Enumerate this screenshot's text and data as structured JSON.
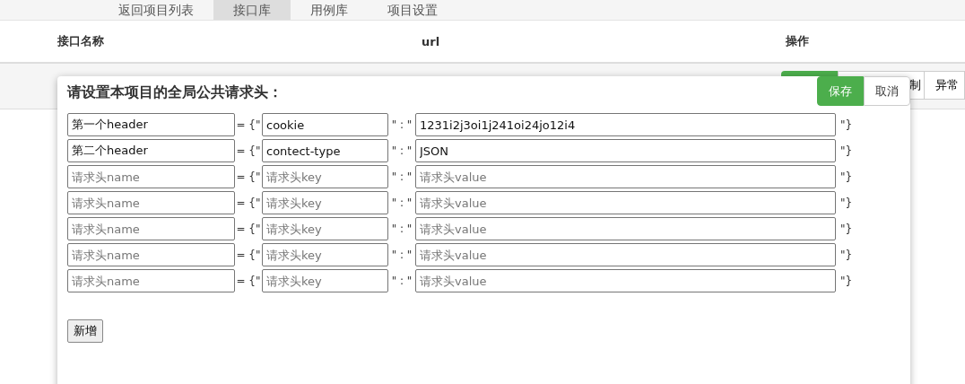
{
  "nav": {
    "tabs": [
      {
        "label": "返回项目列表",
        "selected": false
      },
      {
        "label": "接口库",
        "selected": true
      },
      {
        "label": "用例库",
        "selected": false
      },
      {
        "label": "项目设置",
        "selected": false
      }
    ]
  },
  "table": {
    "columns": [
      "接口名称",
      "url",
      "操作"
    ],
    "row_actions": [
      {
        "label": "制"
      },
      {
        "label": "异常"
      }
    ]
  },
  "dialog": {
    "title": "请设置本项目的全局公共请求头：",
    "save": "保存",
    "cancel": "取消",
    "rows": [
      {
        "name": "第一个header",
        "eq": "= {\"",
        "key": "cookie",
        "colon": "\" : \"",
        "value": "1231i2j3oi1j241oi24jo12i4",
        "close": "\"}"
      },
      {
        "name": "第二个header",
        "eq": "= {\"",
        "key": "contect-type",
        "colon": "\" : \"",
        "value": "JSON",
        "close": "\"}"
      },
      {
        "name_placeholder": "请求头name",
        "eq": "= {\"",
        "key_placeholder": "请求头key",
        "colon": "\" : \"",
        "value_placeholder": "请求头value",
        "close": "\"}"
      },
      {
        "name_placeholder": "请求头name",
        "eq": "= {\"",
        "key_placeholder": "请求头key",
        "colon": "\" : \"",
        "value_placeholder": "请求头value",
        "close": "\"}"
      },
      {
        "name_placeholder": "请求头name",
        "eq": "= {\"",
        "key_placeholder": "请求头key",
        "colon": "\" : \"",
        "value_placeholder": "请求头value",
        "close": "\"}"
      },
      {
        "name_placeholder": "请求头name",
        "eq": "= {\"",
        "key_placeholder": "请求头key",
        "colon": "\" : \"",
        "value_placeholder": "请求头value",
        "close": "\"}"
      },
      {
        "name_placeholder": "请求头name",
        "eq": "= {\"",
        "key_placeholder": "请求头key",
        "colon": "\" : \"",
        "value_placeholder": "请求头value",
        "close": "\"}"
      }
    ],
    "add": "新增"
  }
}
